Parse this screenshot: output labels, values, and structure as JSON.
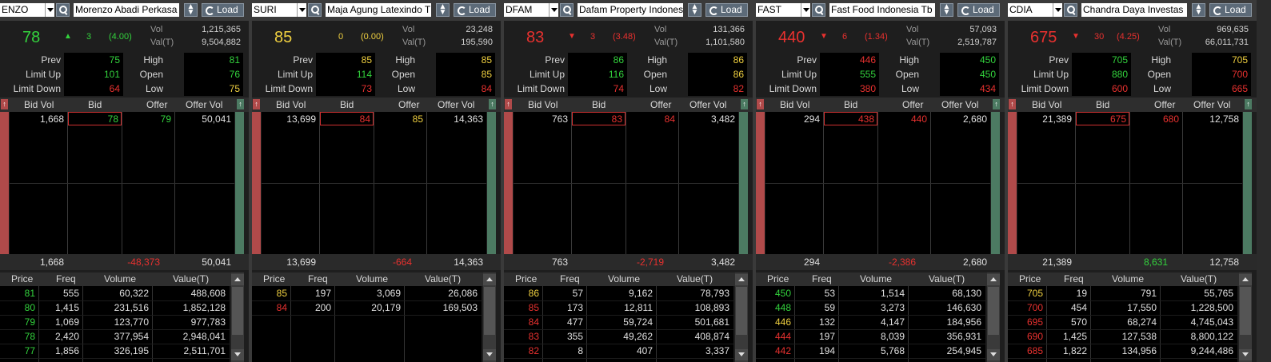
{
  "colors": {
    "up": "#33d33d",
    "down": "#e8312f",
    "unchanged": "#f0d040",
    "neutral": "#e0e0e0"
  },
  "labels": {
    "vol": "Vol",
    "valt": "Val(T)",
    "prev": "Prev",
    "limit_up": "Limit Up",
    "limit_down": "Limit Down",
    "high": "High",
    "open": "Open",
    "low": "Low",
    "bid_vol": "Bid Vol",
    "bid": "Bid",
    "offer": "Offer",
    "offer_vol": "Offer Vol",
    "price": "Price",
    "freq": "Freq",
    "volume": "Volume",
    "value": "Value(T)",
    "load": "Load"
  },
  "panels": [
    {
      "code": "ENZO",
      "name": "Morenzo Abadi Perkasa",
      "last": "78",
      "last_c": "up",
      "arrow": "▲",
      "arrow_c": "up",
      "change": "3",
      "pct": "(4.00)",
      "chg_c": "up",
      "vol": "1,215,365",
      "valt": "9,504,882",
      "prev": "75",
      "prev_c": "up",
      "limit_up": "101",
      "limit_up_c": "up",
      "limit_down": "64",
      "limit_down_c": "down",
      "high": "81",
      "high_c": "up",
      "open": "76",
      "open_c": "up",
      "low": "75",
      "low_c": "unchanged",
      "depth": {
        "bid_vol": "1,668",
        "bid": "78",
        "bid_c": "up",
        "offer": "79",
        "offer_c": "up",
        "offer_vol": "50,041",
        "tot_bid": "1,668",
        "tot_diff": "-48,373",
        "diff_c": "down",
        "tot_offer": "50,041"
      },
      "trades": [
        {
          "p": "81",
          "c": "up",
          "f": "555",
          "v": "60,322",
          "val": "488,608"
        },
        {
          "p": "80",
          "c": "up",
          "f": "1,415",
          "v": "231,516",
          "val": "1,852,128"
        },
        {
          "p": "79",
          "c": "up",
          "f": "1,069",
          "v": "123,770",
          "val": "977,783"
        },
        {
          "p": "78",
          "c": "up",
          "f": "2,420",
          "v": "377,954",
          "val": "2,948,041"
        },
        {
          "p": "77",
          "c": "up",
          "f": "1,856",
          "v": "326,195",
          "val": "2,511,701"
        }
      ]
    },
    {
      "code": "SURI",
      "name": "Maja Agung Latexindo T",
      "last": "85",
      "last_c": "unchanged",
      "arrow": "",
      "arrow_c": "unchanged",
      "change": "0",
      "pct": "(0.00)",
      "chg_c": "unchanged",
      "vol": "23,248",
      "valt": "195,590",
      "prev": "85",
      "prev_c": "unchanged",
      "limit_up": "114",
      "limit_up_c": "up",
      "limit_down": "73",
      "limit_down_c": "down",
      "high": "85",
      "high_c": "unchanged",
      "open": "85",
      "open_c": "unchanged",
      "low": "84",
      "low_c": "down",
      "depth": {
        "bid_vol": "13,699",
        "bid": "84",
        "bid_c": "down",
        "offer": "85",
        "offer_c": "unchanged",
        "offer_vol": "14,363",
        "tot_bid": "13,699",
        "tot_diff": "-664",
        "diff_c": "down",
        "tot_offer": "14,363"
      },
      "trades": [
        {
          "p": "85",
          "c": "unchanged",
          "f": "197",
          "v": "3,069",
          "val": "26,086"
        },
        {
          "p": "84",
          "c": "down",
          "f": "200",
          "v": "20,179",
          "val": "169,503"
        }
      ]
    },
    {
      "code": "DFAM",
      "name": "Dafam Property Indones",
      "last": "83",
      "last_c": "down",
      "arrow": "▼",
      "arrow_c": "down",
      "change": "3",
      "pct": "(3.48)",
      "chg_c": "down",
      "vol": "131,366",
      "valt": "1,101,580",
      "prev": "86",
      "prev_c": "up",
      "limit_up": "116",
      "limit_up_c": "up",
      "limit_down": "74",
      "limit_down_c": "down",
      "high": "86",
      "high_c": "unchanged",
      "open": "86",
      "open_c": "unchanged",
      "low": "82",
      "low_c": "down",
      "depth": {
        "bid_vol": "763",
        "bid": "83",
        "bid_c": "down",
        "offer": "84",
        "offer_c": "down",
        "offer_vol": "3,482",
        "tot_bid": "763",
        "tot_diff": "-2,719",
        "diff_c": "down",
        "tot_offer": "3,482"
      },
      "trades": [
        {
          "p": "86",
          "c": "unchanged",
          "f": "57",
          "v": "9,162",
          "val": "78,793"
        },
        {
          "p": "85",
          "c": "down",
          "f": "173",
          "v": "12,811",
          "val": "108,893"
        },
        {
          "p": "84",
          "c": "down",
          "f": "477",
          "v": "59,724",
          "val": "501,681"
        },
        {
          "p": "83",
          "c": "down",
          "f": "355",
          "v": "49,262",
          "val": "408,874"
        },
        {
          "p": "82",
          "c": "down",
          "f": "8",
          "v": "407",
          "val": "3,337"
        }
      ]
    },
    {
      "code": "FAST",
      "name": "Fast Food Indonesia Tb",
      "last": "440",
      "last_c": "down",
      "arrow": "▼",
      "arrow_c": "down",
      "change": "6",
      "pct": "(1.34)",
      "chg_c": "down",
      "vol": "57,093",
      "valt": "2,519,787",
      "prev": "446",
      "prev_c": "down",
      "limit_up": "555",
      "limit_up_c": "up",
      "limit_down": "380",
      "limit_down_c": "down",
      "high": "450",
      "high_c": "up",
      "open": "450",
      "open_c": "up",
      "low": "434",
      "low_c": "down",
      "depth": {
        "bid_vol": "294",
        "bid": "438",
        "bid_c": "down",
        "offer": "440",
        "offer_c": "down",
        "offer_vol": "2,680",
        "tot_bid": "294",
        "tot_diff": "-2,386",
        "diff_c": "down",
        "tot_offer": "2,680"
      },
      "trades": [
        {
          "p": "450",
          "c": "up",
          "f": "53",
          "v": "1,514",
          "val": "68,130"
        },
        {
          "p": "448",
          "c": "up",
          "f": "59",
          "v": "3,273",
          "val": "146,630"
        },
        {
          "p": "446",
          "c": "unchanged",
          "f": "132",
          "v": "4,147",
          "val": "184,956"
        },
        {
          "p": "444",
          "c": "down",
          "f": "197",
          "v": "8,039",
          "val": "356,931"
        },
        {
          "p": "442",
          "c": "down",
          "f": "194",
          "v": "5,768",
          "val": "254,945"
        }
      ]
    },
    {
      "code": "CDIA",
      "name": "Chandra Daya Investas",
      "last": "675",
      "last_c": "down",
      "arrow": "▼",
      "arrow_c": "down",
      "change": "30",
      "pct": "(4.25)",
      "chg_c": "down",
      "vol": "969,635",
      "valt": "66,011,731",
      "prev": "705",
      "prev_c": "up",
      "limit_up": "880",
      "limit_up_c": "up",
      "limit_down": "600",
      "limit_down_c": "down",
      "high": "705",
      "high_c": "unchanged",
      "open": "700",
      "open_c": "down",
      "low": "665",
      "low_c": "down",
      "depth": {
        "bid_vol": "21,389",
        "bid": "675",
        "bid_c": "down",
        "offer": "680",
        "offer_c": "down",
        "offer_vol": "12,758",
        "tot_bid": "21,389",
        "tot_diff": "8,631",
        "diff_c": "up",
        "tot_offer": "12,758"
      },
      "trades": [
        {
          "p": "705",
          "c": "unchanged",
          "f": "19",
          "v": "791",
          "val": "55,765"
        },
        {
          "p": "700",
          "c": "down",
          "f": "454",
          "v": "17,550",
          "val": "1,228,500"
        },
        {
          "p": "695",
          "c": "down",
          "f": "570",
          "v": "68,274",
          "val": "4,745,043"
        },
        {
          "p": "690",
          "c": "down",
          "f": "1,425",
          "v": "127,538",
          "val": "8,800,122"
        },
        {
          "p": "685",
          "c": "down",
          "f": "1,822",
          "v": "134,956",
          "val": "9,244,486"
        }
      ]
    }
  ]
}
